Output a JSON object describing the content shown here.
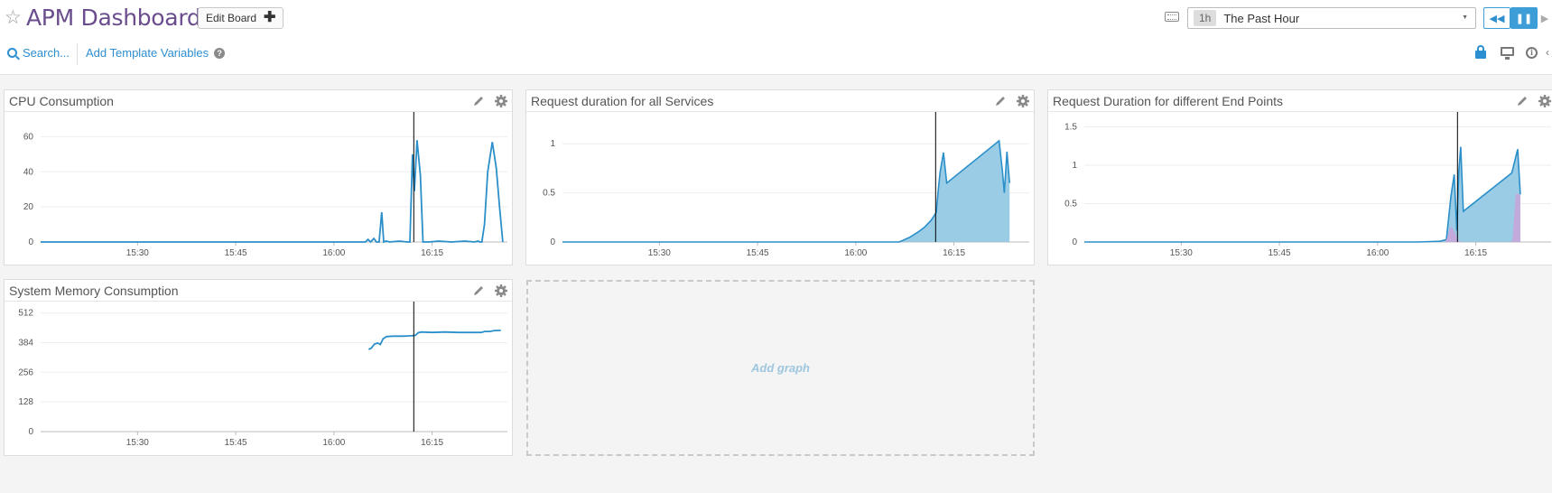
{
  "header": {
    "title": "APM Dashboard",
    "edit_board_label": "Edit Board",
    "time_badge": "1h",
    "time_label": "The Past Hour"
  },
  "toolbar": {
    "search_label": "Search...",
    "template_vars_label": "Add Template Variables"
  },
  "colors": {
    "accent": "#2d8ed0",
    "series_primary": "#2b8fc9",
    "series_fill": "#8fc6e3",
    "series_secondary": "#c9a3d9",
    "title_purple": "#6a4d8c"
  },
  "icons": [
    "star-icon",
    "keyboard-icon",
    "rewind-icon",
    "pause-icon",
    "play-icon",
    "search-icon",
    "help-icon",
    "lock-icon",
    "monitor-icon",
    "info-icon",
    "pencil-icon",
    "gear-icon"
  ],
  "widgets": [
    {
      "title": "CPU Consumption"
    },
    {
      "title": "Request duration for all Services"
    },
    {
      "title": "Request Duration for different End Points"
    },
    {
      "title": "System Memory Consumption"
    }
  ],
  "add_graph_label": "Add graph",
  "chart_data": [
    {
      "type": "line",
      "title": "CPU Consumption",
      "x_ticks": [
        "15:30",
        "15:45",
        "16:00",
        "16:15"
      ],
      "y_ticks": [
        "0",
        "20",
        "40",
        "60"
      ],
      "ylim": [
        0,
        70
      ],
      "xlim_minutes": [
        15.2,
        86.5
      ],
      "marker_minute": 72.2,
      "grid": true,
      "series": [
        {
          "values": [
            [
              15.2,
              0
            ],
            [
              64.8,
              0
            ],
            [
              65.2,
              1.5
            ],
            [
              65.6,
              0
            ],
            [
              66.1,
              2
            ],
            [
              66.5,
              0
            ],
            [
              66.9,
              0
            ],
            [
              67.3,
              17
            ],
            [
              67.6,
              0
            ],
            [
              68,
              0.5
            ],
            [
              68.5,
              0
            ],
            [
              70,
              0.5
            ],
            [
              71.2,
              0
            ],
            [
              71.6,
              0
            ],
            [
              72,
              50
            ],
            [
              72.3,
              29
            ],
            [
              72.7,
              58
            ],
            [
              73.2,
              38
            ],
            [
              73.6,
              0
            ],
            [
              74.5,
              0
            ],
            [
              76,
              0.5
            ],
            [
              78,
              0
            ],
            [
              80,
              0.5
            ],
            [
              81.5,
              0
            ],
            [
              82,
              0.5
            ],
            [
              82.3,
              0
            ],
            [
              82.6,
              0
            ],
            [
              83,
              10
            ],
            [
              83.5,
              40
            ],
            [
              84.2,
              57
            ],
            [
              84.8,
              42
            ],
            [
              85.3,
              20
            ],
            [
              85.8,
              0
            ]
          ]
        }
      ]
    },
    {
      "type": "area",
      "title": "Request duration for all Services",
      "x_ticks": [
        "15:30",
        "15:45",
        "16:00",
        "16:15"
      ],
      "y_ticks": [
        "0",
        "0.5",
        "1"
      ],
      "ylim": [
        0,
        1.25
      ],
      "xlim_minutes": [
        15.2,
        86.5
      ],
      "marker_minute": 72.2,
      "grid": true,
      "series": [
        {
          "values": [
            [
              15.2,
              0
            ],
            [
              66.6,
              0
            ],
            [
              67,
              0.01
            ],
            [
              68.3,
              0.05
            ],
            [
              69.5,
              0.1
            ],
            [
              70.5,
              0.15
            ],
            [
              71.5,
              0.22
            ],
            [
              72.3,
              0.3
            ],
            [
              72.6,
              0.53
            ],
            [
              72.9,
              0.72
            ],
            [
              73.4,
              0.91
            ],
            [
              73.9,
              0.6
            ],
            [
              81.9,
              1.03
            ],
            [
              82.4,
              0.72
            ],
            [
              82.7,
              0.5
            ],
            [
              83.1,
              0.92
            ],
            [
              83.5,
              0.6
            ]
          ]
        }
      ]
    },
    {
      "type": "area",
      "title": "Request Duration for different End Points",
      "x_ticks": [
        "15:30",
        "15:45",
        "16:00",
        "16:15"
      ],
      "y_ticks": [
        "0",
        "0.5",
        "1",
        "1.5"
      ],
      "ylim": [
        0,
        1.6
      ],
      "xlim_minutes": [
        15.2,
        86.5
      ],
      "marker_minute": 72.2,
      "grid": true,
      "series": [
        {
          "values": [
            [
              15.2,
              0
            ],
            [
              66.2,
              0
            ],
            [
              69.5,
              0.01
            ],
            [
              70.5,
              0.03
            ],
            [
              71.2,
              0.6
            ],
            [
              71.7,
              0.88
            ],
            [
              72.1,
              0.15
            ],
            [
              72.4,
              0.92
            ],
            [
              72.7,
              1.24
            ],
            [
              73.1,
              0.4
            ],
            [
              80.5,
              0.9
            ],
            [
              81.4,
              1.21
            ],
            [
              81.8,
              0.62
            ]
          ]
        },
        {
          "values": [
            [
              15.2,
              0
            ],
            [
              70.3,
              0
            ],
            [
              70.6,
              0.05
            ],
            [
              71.1,
              0.2
            ],
            [
              71.5,
              0.18
            ],
            [
              72.3,
              0.02
            ],
            [
              72.7,
              0
            ],
            [
              80.3,
              0
            ],
            [
              80.6,
              0.02
            ],
            [
              81.1,
              0.63
            ],
            [
              81.8,
              0.62
            ]
          ]
        }
      ]
    },
    {
      "type": "line",
      "title": "System Memory Consumption",
      "x_ticks": [
        "15:30",
        "15:45",
        "16:00",
        "16:15"
      ],
      "y_ticks": [
        "0",
        "128",
        "256",
        "384",
        "512"
      ],
      "ylim": [
        0,
        530
      ],
      "xlim_minutes": [
        15.2,
        86.5
      ],
      "marker_minute": 72.2,
      "grid": true,
      "series": [
        {
          "values": [
            [
              65.3,
              355
            ],
            [
              65.7,
              360
            ],
            [
              66.2,
              378
            ],
            [
              66.7,
              382
            ],
            [
              67.1,
              376
            ],
            [
              67.5,
              400
            ],
            [
              68,
              410
            ],
            [
              69,
              412
            ],
            [
              70.5,
              412
            ],
            [
              71.5,
              413
            ],
            [
              72.4,
              415
            ],
            [
              72.9,
              427
            ],
            [
              73.4,
              430
            ],
            [
              75,
              428
            ],
            [
              77,
              430
            ],
            [
              79,
              428
            ],
            [
              81.5,
              428
            ],
            [
              82.5,
              428
            ],
            [
              83,
              432
            ],
            [
              83.8,
              432
            ],
            [
              84.5,
              436
            ],
            [
              85.5,
              437
            ]
          ]
        }
      ]
    }
  ]
}
